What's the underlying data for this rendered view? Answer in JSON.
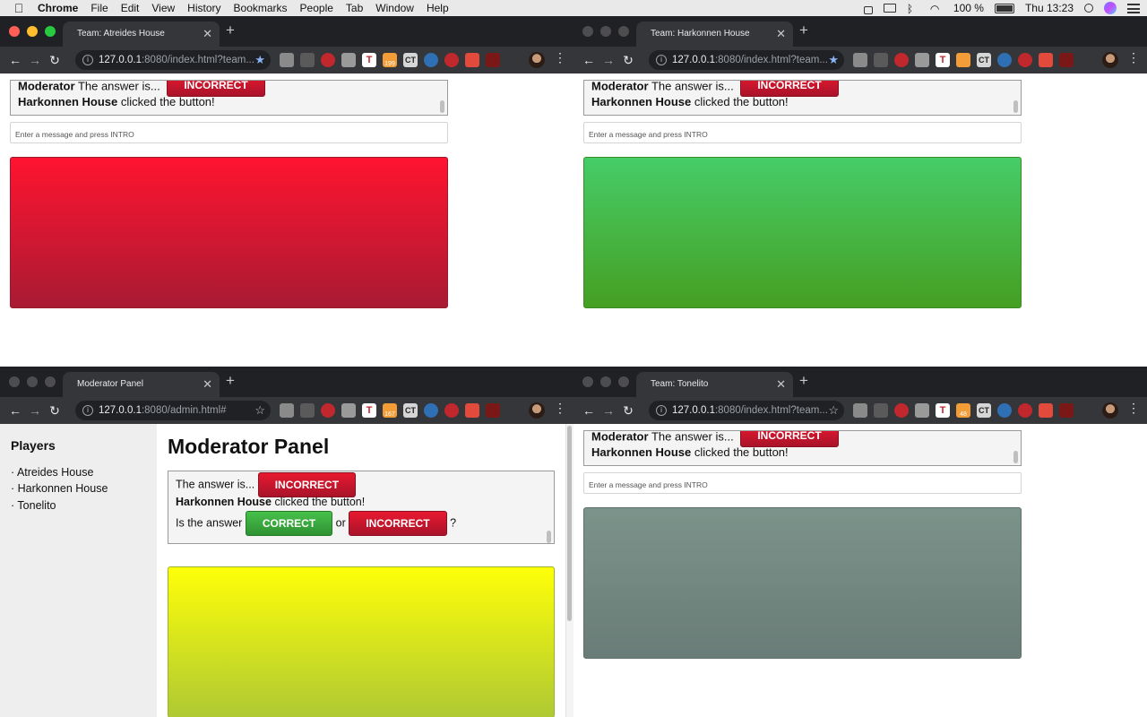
{
  "menubar": {
    "apple": "",
    "app": "Chrome",
    "items": [
      "File",
      "Edit",
      "View",
      "History",
      "Bookmarks",
      "People",
      "Tab",
      "Window",
      "Help"
    ],
    "battery": "100 %",
    "clock": "Thu 13:23"
  },
  "windows": {
    "atreides": {
      "tab_title": "Team: Atreides House",
      "url_host": "127.0.0.1",
      "url_rest": ":8080/index.html?team...",
      "log": {
        "moderator_name": "Moderator",
        "moderator_text": " The answer is...",
        "incorrect_label": "INCORRECT",
        "team_name": "Harkonnen House",
        "team_text": " clicked the button!"
      },
      "message_placeholder": "Enter a message and press INTRO",
      "status_color": "#e8192f"
    },
    "harkonnen": {
      "tab_title": "Team: Harkonnen House",
      "url_host": "127.0.0.1",
      "url_rest": ":8080/index.html?team...",
      "log": {
        "moderator_name": "Moderator",
        "moderator_text": " The answer is...",
        "incorrect_label": "INCORRECT",
        "team_name": "Harkonnen House",
        "team_text": " clicked the button!"
      },
      "message_placeholder": "Enter a message and press INTRO",
      "status_color": "#45c35f"
    },
    "moderator": {
      "tab_title": "Moderator Panel",
      "url_host": "127.0.0.1",
      "url_rest": ":8080/admin.html#",
      "players_heading": "Players",
      "players": [
        "· Atreides House",
        "· Harkonnen House",
        "· Tonelito"
      ],
      "title": "Moderator Panel",
      "log": {
        "answer_text": "The answer is...",
        "incorrect_label": "INCORRECT",
        "team_name": "Harkonnen House",
        "team_text": " clicked the button!",
        "question_text": "Is the answer",
        "correct_label": "CORRECT",
        "or_text": "or",
        "incorrect_label_2": "INCORRECT",
        "question_mark": "?"
      },
      "status_color": "#e9f51b"
    },
    "tonelito": {
      "tab_title": "Team: Tonelito",
      "url_host": "127.0.0.1",
      "url_rest": ":8080/index.html?team...",
      "log": {
        "moderator_name": "Moderator",
        "moderator_text": " The answer is...",
        "incorrect_label": "INCORRECT",
        "team_name": "Harkonnen House",
        "team_text": " clicked the button!"
      },
      "message_placeholder": "Enter a message and press INTRO",
      "status_color": "#738b83"
    }
  },
  "extensions": {
    "badge_a": "199",
    "badge_b": "167",
    "badge_c": "48",
    "ct": "CT",
    "t": "T"
  }
}
